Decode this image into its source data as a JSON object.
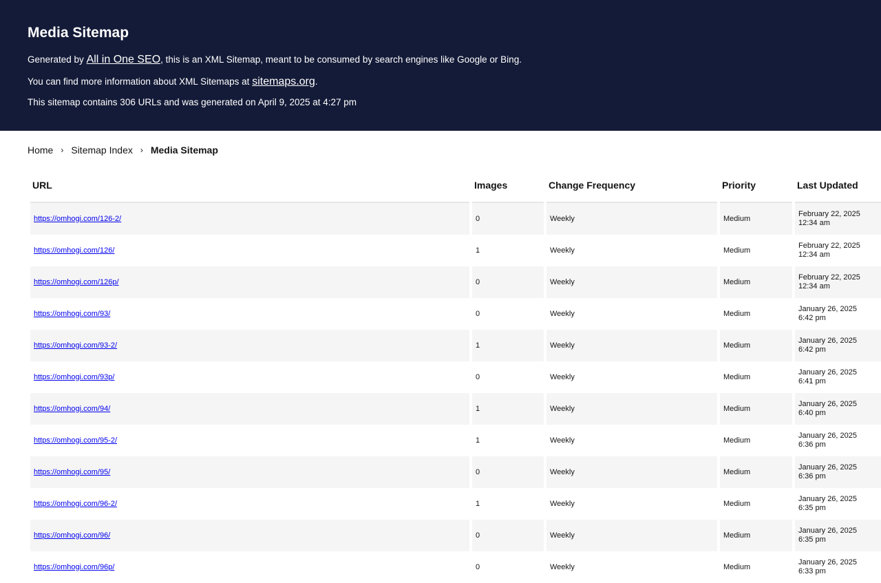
{
  "header": {
    "title": "Media Sitemap",
    "line1_prefix": "Generated by ",
    "line1_link": "All in One SEO",
    "line1_suffix": ", this is an XML Sitemap, meant to be consumed by search engines like Google or Bing.",
    "line2_prefix": "You can find more information about XML Sitemaps at ",
    "line2_link": "sitemaps.org",
    "line2_suffix": ".",
    "line3": "This sitemap contains 306 URLs and was generated on April 9, 2025 at 4:27 pm"
  },
  "breadcrumb": {
    "home": "Home",
    "index": "Sitemap Index",
    "current": "Media Sitemap",
    "separator": "›"
  },
  "table": {
    "columns": [
      "URL",
      "Images",
      "Change Frequency",
      "Priority",
      "Last Updated"
    ],
    "rows": [
      {
        "url": "https://omhogi.com/126-2/",
        "images": "0",
        "freq": "Weekly",
        "priority": "Medium",
        "date": "February 22, 2025",
        "time": "12:34 am"
      },
      {
        "url": "https://omhogi.com/126/",
        "images": "1",
        "freq": "Weekly",
        "priority": "Medium",
        "date": "February 22, 2025",
        "time": "12:34 am"
      },
      {
        "url": "https://omhogi.com/126p/",
        "images": "0",
        "freq": "Weekly",
        "priority": "Medium",
        "date": "February 22, 2025",
        "time": "12:34 am"
      },
      {
        "url": "https://omhogi.com/93/",
        "images": "0",
        "freq": "Weekly",
        "priority": "Medium",
        "date": "January 26, 2025",
        "time": "6:42 pm"
      },
      {
        "url": "https://omhogi.com/93-2/",
        "images": "1",
        "freq": "Weekly",
        "priority": "Medium",
        "date": "January 26, 2025",
        "time": "6:42 pm"
      },
      {
        "url": "https://omhogi.com/93p/",
        "images": "0",
        "freq": "Weekly",
        "priority": "Medium",
        "date": "January 26, 2025",
        "time": "6:41 pm"
      },
      {
        "url": "https://omhogi.com/94/",
        "images": "1",
        "freq": "Weekly",
        "priority": "Medium",
        "date": "January 26, 2025",
        "time": "6:40 pm"
      },
      {
        "url": "https://omhogi.com/95-2/",
        "images": "1",
        "freq": "Weekly",
        "priority": "Medium",
        "date": "January 26, 2025",
        "time": "6:36 pm"
      },
      {
        "url": "https://omhogi.com/95/",
        "images": "0",
        "freq": "Weekly",
        "priority": "Medium",
        "date": "January 26, 2025",
        "time": "6:36 pm"
      },
      {
        "url": "https://omhogi.com/96-2/",
        "images": "1",
        "freq": "Weekly",
        "priority": "Medium",
        "date": "January 26, 2025",
        "time": "6:35 pm"
      },
      {
        "url": "https://omhogi.com/96/",
        "images": "0",
        "freq": "Weekly",
        "priority": "Medium",
        "date": "January 26, 2025",
        "time": "6:35 pm"
      },
      {
        "url": "https://omhogi.com/96p/",
        "images": "0",
        "freq": "Weekly",
        "priority": "Medium",
        "date": "January 26, 2025",
        "time": "6:33 pm"
      }
    ]
  },
  "colors": {
    "header_bg": "#141b38",
    "row_alt_bg": "#f5f5f5",
    "link": "#0000ee"
  }
}
